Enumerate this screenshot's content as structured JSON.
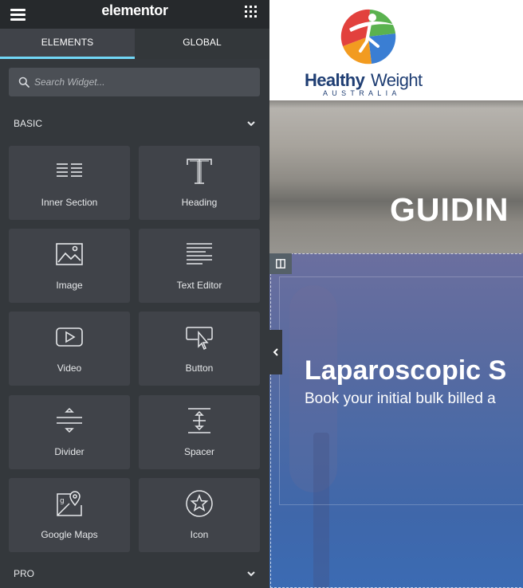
{
  "panel": {
    "logo": "elementor",
    "tabs": [
      {
        "label": "ELEMENTS",
        "active": true
      },
      {
        "label": "GLOBAL",
        "active": false
      }
    ],
    "search": {
      "placeholder": "Search Widget..."
    },
    "categories": {
      "basic": "BASIC",
      "pro": "PRO"
    },
    "widgets": [
      {
        "label": "Inner Section",
        "icon": "inner-section-icon"
      },
      {
        "label": "Heading",
        "icon": "heading-icon"
      },
      {
        "label": "Image",
        "icon": "image-icon"
      },
      {
        "label": "Text Editor",
        "icon": "text-editor-icon"
      },
      {
        "label": "Video",
        "icon": "video-icon"
      },
      {
        "label": "Button",
        "icon": "button-icon"
      },
      {
        "label": "Divider",
        "icon": "divider-icon"
      },
      {
        "label": "Spacer",
        "icon": "spacer-icon"
      },
      {
        "label": "Google Maps",
        "icon": "google-maps-icon"
      },
      {
        "label": "Icon",
        "icon": "star-icon"
      }
    ],
    "colors": {
      "accent": "#71d7f7",
      "panel_bg": "#34383c",
      "widget_bg": "#404349"
    }
  },
  "canvas": {
    "logo": {
      "word_bold": "Healthy",
      "word_light": "Weight",
      "sub": "AUSTRALIA"
    },
    "hero_title": "GUIDIN",
    "section": {
      "heading": "Laparoscopic S",
      "subtext": "Book your initial bulk billed a"
    }
  }
}
